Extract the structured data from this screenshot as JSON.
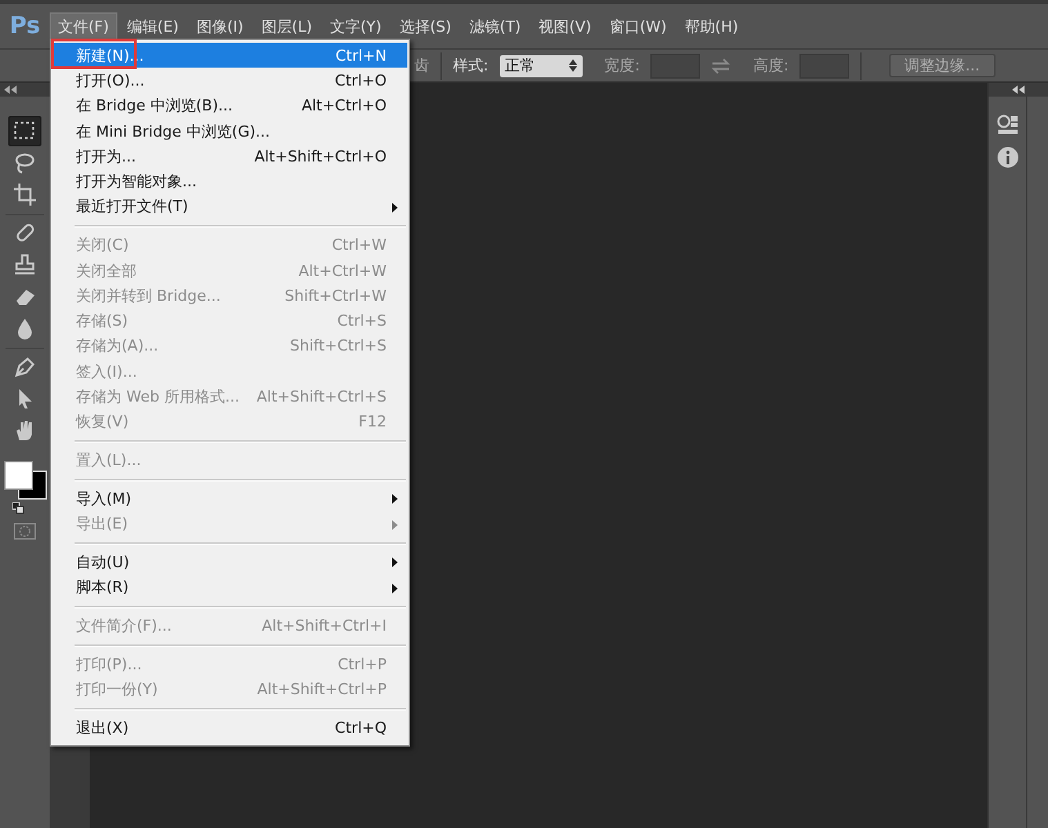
{
  "app": {
    "logo": "Ps"
  },
  "menubar": [
    {
      "label": "文件(F)",
      "selected": true
    },
    {
      "label": "编辑(E)",
      "selected": false
    },
    {
      "label": "图像(I)",
      "selected": false
    },
    {
      "label": "图层(L)",
      "selected": false
    },
    {
      "label": "文字(Y)",
      "selected": false
    },
    {
      "label": "选择(S)",
      "selected": false
    },
    {
      "label": "滤镜(T)",
      "selected": false
    },
    {
      "label": "视图(V)",
      "selected": false
    },
    {
      "label": "窗口(W)",
      "selected": false
    },
    {
      "label": "帮助(H)",
      "selected": false
    }
  ],
  "options_bar": {
    "covered_label": "齿",
    "style_label": "样式:",
    "style_value": "正常",
    "width_label": "宽度:",
    "height_label": "高度:",
    "refine_button": "调整边缘..."
  },
  "toolbar": {
    "tools": [
      {
        "kind": "marquee",
        "selected": true
      },
      {
        "kind": "lasso",
        "selected": false
      },
      {
        "kind": "crop",
        "selected": false
      },
      {
        "kind": "separator"
      },
      {
        "kind": "bandage",
        "selected": false
      },
      {
        "kind": "stamp",
        "selected": false
      },
      {
        "kind": "eraser",
        "selected": false
      },
      {
        "kind": "drop",
        "selected": false
      },
      {
        "kind": "separator"
      },
      {
        "kind": "pen",
        "selected": false
      },
      {
        "kind": "pointer",
        "selected": false
      },
      {
        "kind": "hand",
        "selected": false
      }
    ]
  },
  "file_menu": {
    "items": [
      {
        "kind": "item",
        "label": "新建(N)...",
        "shortcut": "Ctrl+N",
        "disabled": false,
        "selected": true,
        "submenu": false,
        "annotated": true
      },
      {
        "kind": "item",
        "label": "打开(O)...",
        "shortcut": "Ctrl+O",
        "disabled": false,
        "selected": false,
        "submenu": false,
        "annotated": false
      },
      {
        "kind": "item",
        "label": "在 Bridge 中浏览(B)...",
        "shortcut": "Alt+Ctrl+O",
        "disabled": false,
        "selected": false,
        "submenu": false,
        "annotated": false
      },
      {
        "kind": "item",
        "label": "在 Mini Bridge 中浏览(G)...",
        "disabled": false,
        "selected": false,
        "submenu": false,
        "annotated": false
      },
      {
        "kind": "item",
        "label": "打开为...",
        "shortcut": "Alt+Shift+Ctrl+O",
        "disabled": false,
        "selected": false,
        "submenu": false,
        "annotated": false
      },
      {
        "kind": "item",
        "label": "打开为智能对象...",
        "disabled": false,
        "selected": false,
        "submenu": false,
        "annotated": false
      },
      {
        "kind": "item",
        "label": "最近打开文件(T)",
        "disabled": false,
        "selected": false,
        "submenu": true,
        "annotated": false
      },
      {
        "kind": "separator"
      },
      {
        "kind": "item",
        "label": "关闭(C)",
        "shortcut": "Ctrl+W",
        "disabled": true,
        "selected": false,
        "submenu": false,
        "annotated": false
      },
      {
        "kind": "item",
        "label": "关闭全部",
        "shortcut": "Alt+Ctrl+W",
        "disabled": true,
        "selected": false,
        "submenu": false,
        "annotated": false
      },
      {
        "kind": "item",
        "label": "关闭并转到 Bridge...",
        "shortcut": "Shift+Ctrl+W",
        "disabled": true,
        "selected": false,
        "submenu": false,
        "annotated": false
      },
      {
        "kind": "item",
        "label": "存储(S)",
        "shortcut": "Ctrl+S",
        "disabled": true,
        "selected": false,
        "submenu": false,
        "annotated": false
      },
      {
        "kind": "item",
        "label": "存储为(A)...",
        "shortcut": "Shift+Ctrl+S",
        "disabled": true,
        "selected": false,
        "submenu": false,
        "annotated": false
      },
      {
        "kind": "item",
        "label": "签入(I)...",
        "disabled": true,
        "selected": false,
        "submenu": false,
        "annotated": false
      },
      {
        "kind": "item",
        "label": "存储为 Web 所用格式...",
        "shortcut": "Alt+Shift+Ctrl+S",
        "disabled": true,
        "selected": false,
        "submenu": false,
        "annotated": false
      },
      {
        "kind": "item",
        "label": "恢复(V)",
        "shortcut": "F12",
        "disabled": true,
        "selected": false,
        "submenu": false,
        "annotated": false
      },
      {
        "kind": "separator"
      },
      {
        "kind": "item",
        "label": "置入(L)...",
        "disabled": true,
        "selected": false,
        "submenu": false,
        "annotated": false
      },
      {
        "kind": "separator"
      },
      {
        "kind": "item",
        "label": "导入(M)",
        "disabled": false,
        "selected": false,
        "submenu": true,
        "annotated": false
      },
      {
        "kind": "item",
        "label": "导出(E)",
        "disabled": true,
        "selected": false,
        "submenu": true,
        "annotated": false
      },
      {
        "kind": "separator"
      },
      {
        "kind": "item",
        "label": "自动(U)",
        "disabled": false,
        "selected": false,
        "submenu": true,
        "annotated": false
      },
      {
        "kind": "item",
        "label": "脚本(R)",
        "disabled": false,
        "selected": false,
        "submenu": true,
        "annotated": false
      },
      {
        "kind": "separator"
      },
      {
        "kind": "item",
        "label": "文件简介(F)...",
        "shortcut": "Alt+Shift+Ctrl+I",
        "disabled": true,
        "selected": false,
        "submenu": false,
        "annotated": false
      },
      {
        "kind": "separator"
      },
      {
        "kind": "item",
        "label": "打印(P)...",
        "shortcut": "Ctrl+P",
        "disabled": true,
        "selected": false,
        "submenu": false,
        "annotated": false
      },
      {
        "kind": "item",
        "label": "打印一份(Y)",
        "shortcut": "Alt+Shift+Ctrl+P",
        "disabled": true,
        "selected": false,
        "submenu": false,
        "annotated": false
      },
      {
        "kind": "separator"
      },
      {
        "kind": "item",
        "label": "退出(X)",
        "shortcut": "Ctrl+Q",
        "disabled": false,
        "selected": false,
        "submenu": false,
        "annotated": false
      }
    ]
  }
}
